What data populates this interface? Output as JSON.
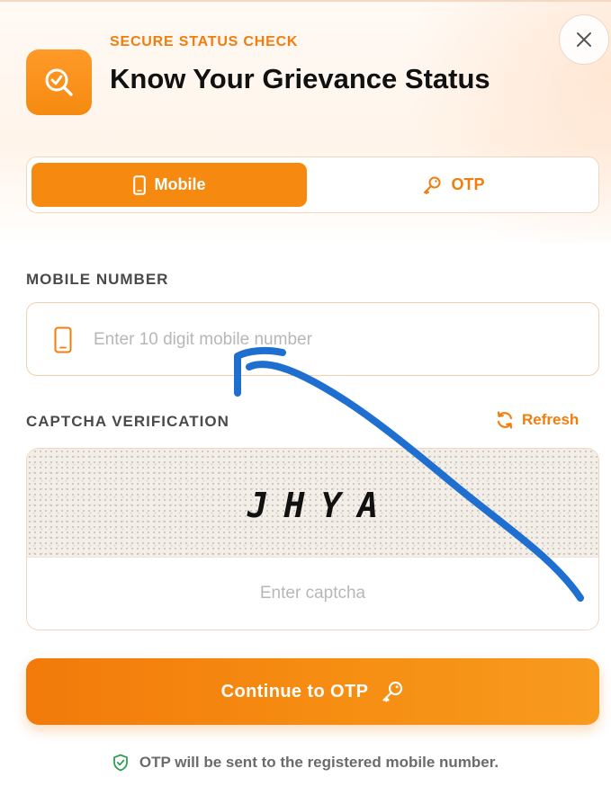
{
  "header": {
    "eyebrow": "SECURE STATUS CHECK",
    "title": "Know Your Grievance Status",
    "icon": "search-check-icon",
    "close_icon": "close-icon"
  },
  "toggle": {
    "options": [
      {
        "label": "Mobile",
        "icon": "mobile-icon",
        "active": true
      },
      {
        "label": "OTP",
        "icon": "key-icon",
        "active": false
      }
    ]
  },
  "mobile": {
    "label": "MOBILE NUMBER",
    "placeholder": "Enter 10 digit mobile number",
    "value": "",
    "icon": "mobile-icon"
  },
  "captcha": {
    "label": "CAPTCHA VERIFICATION",
    "refresh_label": "Refresh",
    "refresh_icon": "refresh-icon",
    "code": "JHYA",
    "placeholder": "Enter captcha",
    "value": ""
  },
  "actions": {
    "continue_label": "Continue to OTP",
    "continue_icon": "key-icon"
  },
  "footnote": {
    "text": "OTP will be sent to the registered mobile number.",
    "icon": "shield-check-icon"
  },
  "colors": {
    "accent": "#f68a10",
    "accent_text": "#f27d0c",
    "annotation_stroke": "#1f6fd1"
  }
}
